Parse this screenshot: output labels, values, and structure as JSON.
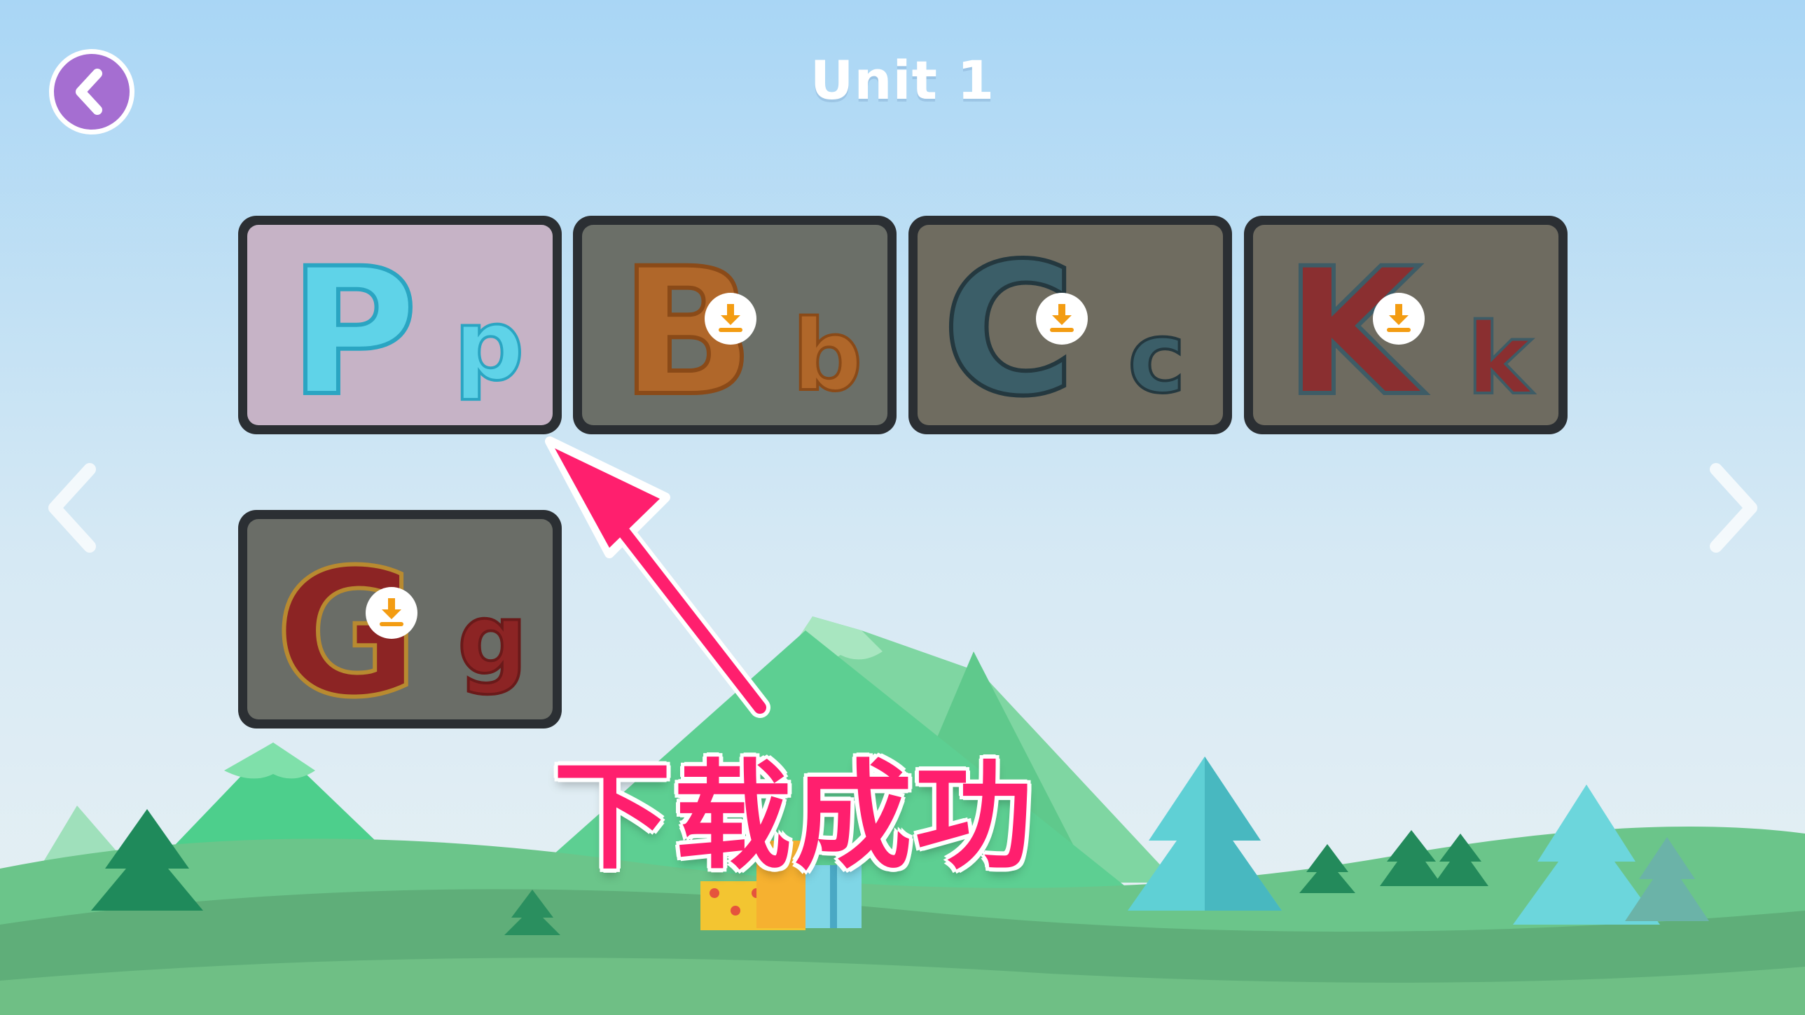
{
  "header": {
    "title": "Unit 1"
  },
  "navigation": {
    "back_icon": "chevron-left-icon",
    "prev_icon": "chevron-left-icon",
    "next_icon": "chevron-right-icon"
  },
  "cards": [
    {
      "upper": "P",
      "lower": "p",
      "downloaded": true,
      "bg": "#c6b3c6",
      "letter_color": "#5fd3e8",
      "outline": "#2aa5c2"
    },
    {
      "upper": "B",
      "lower": "b",
      "downloaded": false,
      "bg": "#6b6f68",
      "letter_color": "#b0672a",
      "outline": "#8a4a18"
    },
    {
      "upper": "C",
      "lower": "c",
      "downloaded": false,
      "bg": "#6f6c60",
      "letter_color": "#3b5e68",
      "outline": "#24383f"
    },
    {
      "upper": "K",
      "lower": "k",
      "downloaded": false,
      "bg": "#6e6b60",
      "letter_color": "#8a2f30",
      "outline": "#3e5c66"
    },
    {
      "upper": "G",
      "lower": "g",
      "downloaded": false,
      "bg": "#6a6d67",
      "letter_color": "#8c2424",
      "outline": "#b88a30"
    }
  ],
  "annotation": {
    "text": "下载成功"
  },
  "colors": {
    "accent": "#a56ed1",
    "annotation": "#ff1f6e",
    "download_icon": "#f39c12"
  }
}
